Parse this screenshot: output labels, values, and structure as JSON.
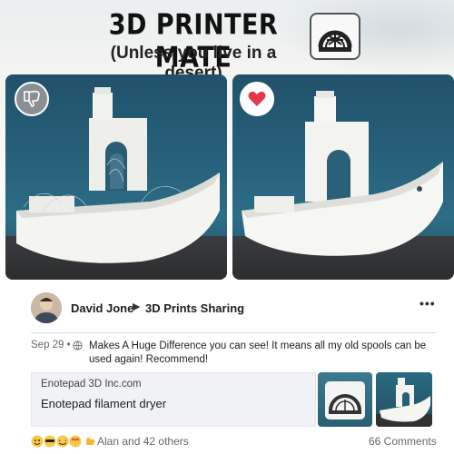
{
  "hero": {
    "headline": "3D PRINTER MATE",
    "subline": "(Unless you live in a desert)",
    "logo_icon": "filament-spool-icon",
    "left_badge_icon": "thumbs-down-icon",
    "right_badge_icon": "heart-icon"
  },
  "post": {
    "author": "David Jone",
    "group": "3D Prints Sharing",
    "more_label": "•••",
    "date": "Sep 29 •",
    "privacy_icon": "globe-icon",
    "text": "Makes A Huge Difference you can see! It means all my old spools can be used again! Recommend!",
    "link": {
      "domain": "Enotepad 3D Inc.com",
      "title": "Enotepad filament dryer"
    },
    "reactions_text": "Alan and 42 others",
    "comments_text": "66 Comments"
  },
  "colors": {
    "heart": "#e23a4a",
    "text_primary": "#1c1e21",
    "text_secondary": "#65676b"
  }
}
